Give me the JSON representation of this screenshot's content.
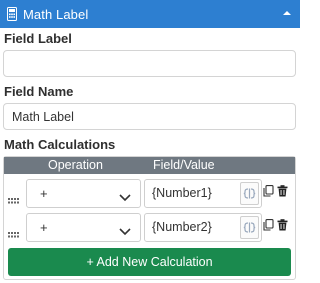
{
  "header": {
    "title": "Math Label",
    "icon": "calculator-icon",
    "collapse_icon": "chevron-up-icon",
    "bg_color": "#2d7fd1"
  },
  "field_label": {
    "label": "Field Label",
    "value": ""
  },
  "field_name": {
    "label": "Field Name",
    "value": "Math Label"
  },
  "math_calculations": {
    "label": "Math Calculations",
    "columns": [
      "Operation",
      "Field/Value"
    ],
    "rows": [
      {
        "operation": "+",
        "field_value": "{Number1}"
      },
      {
        "operation": "+",
        "field_value": "{Number2}"
      }
    ],
    "add_button_label": "+ Add New Calculation",
    "add_button_color": "#1a8a4e"
  }
}
